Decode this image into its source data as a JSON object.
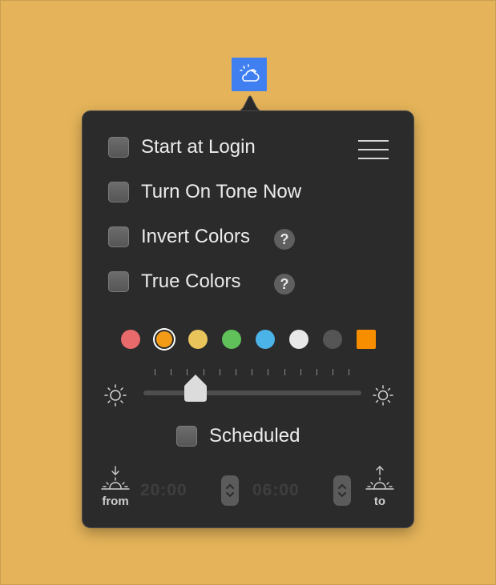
{
  "colors": {
    "desktop": "#e5b45a",
    "menubar_highlight": "#3f7ff0",
    "popover_bg": "#2b2b2b"
  },
  "menubar": {
    "icon": "cloud-sun-icon"
  },
  "options": [
    {
      "label": "Start at Login",
      "checked": false,
      "help": false
    },
    {
      "label": "Turn On Tone Now",
      "checked": false,
      "help": false
    },
    {
      "label": "Invert Colors",
      "checked": false,
      "help": true
    },
    {
      "label": "True Colors",
      "checked": false,
      "help": true
    }
  ],
  "help_label": "?",
  "menu_icon": "hamburger-menu-icon",
  "color_swatches": [
    {
      "color": "#e86a6a",
      "selected": false
    },
    {
      "color": "#f39a17",
      "selected": true
    },
    {
      "color": "#e9c45a",
      "selected": false
    },
    {
      "color": "#60c15a",
      "selected": false
    },
    {
      "color": "#4cb3e8",
      "selected": false
    },
    {
      "color": "#e8e8e8",
      "selected": false
    },
    {
      "color": "#555555",
      "selected": false
    },
    {
      "color": "#f78e00",
      "selected": false,
      "shape": "square"
    }
  ],
  "intensity": {
    "value": 0.18,
    "min_icon": "dim-sun-icon",
    "max_icon": "bright-sun-icon"
  },
  "scheduled": {
    "label": "Scheduled",
    "checked": false
  },
  "schedule": {
    "from_label": "from",
    "to_label": "to",
    "from_time": "20:00",
    "to_time": "06:00",
    "from_icon": "sunset-icon",
    "to_icon": "sunrise-icon"
  }
}
